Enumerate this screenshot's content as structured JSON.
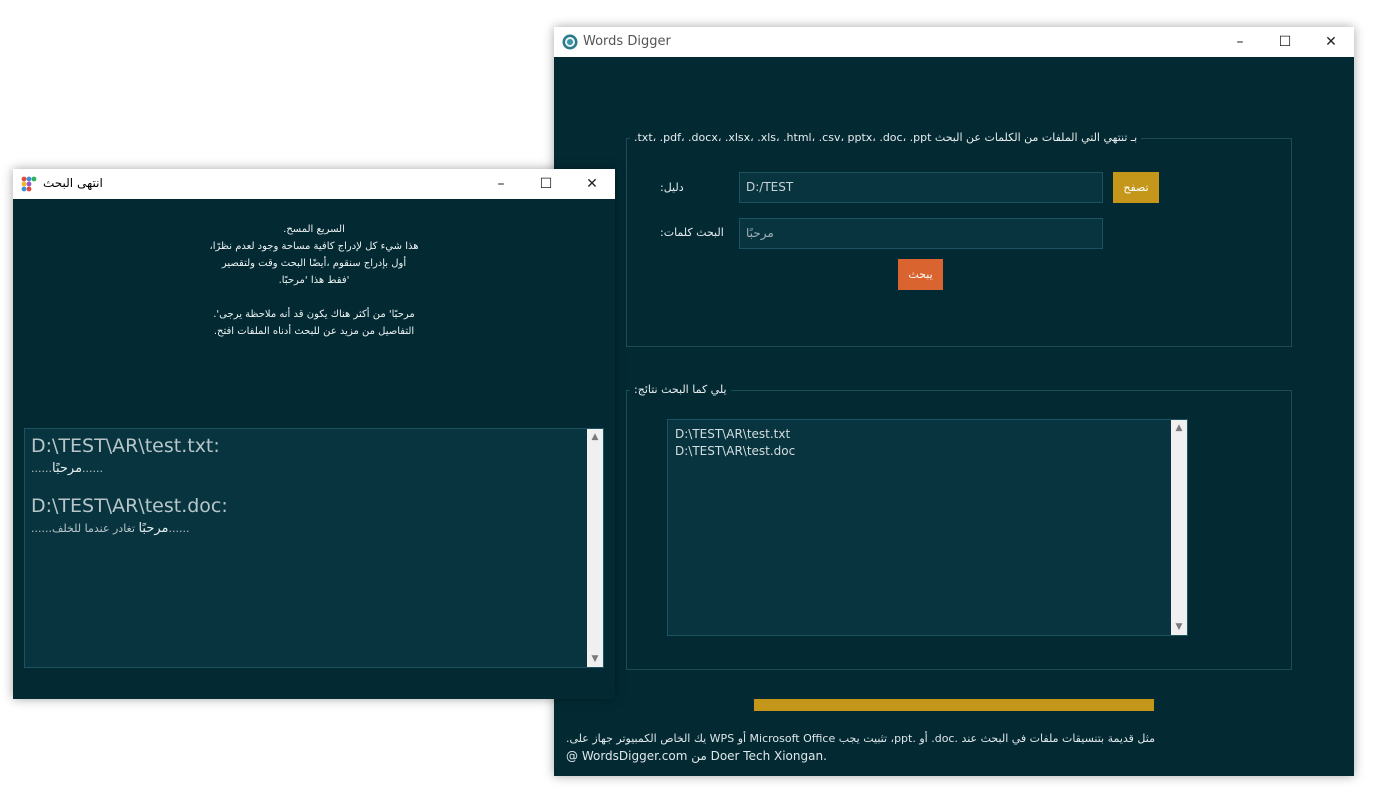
{
  "main_window": {
    "title": "Words Digger",
    "file_types_label": ".txt، .pdf، .docx، .xlsx، .xls، .html، .csv، pptx، .doc، .ppt بـ تنتهي التي الملفات من الكلمات عن البحث",
    "dir_label": ":دليل",
    "dir_value": "D:/TEST",
    "browse_label": "تصفح",
    "keywords_label": ":البحث كلمات",
    "keywords_value": "مرحبًا",
    "search_label": "يبحث",
    "results_label": ":يلي كما البحث نتائج",
    "results": [
      "D:\\TEST\\AR\\test.txt",
      "D:\\TEST\\AR\\test.doc"
    ],
    "progress": 1.0,
    "footer_line1": ".يك الخاص الكمبيوتر جهاز على WPS أو Microsoft Office تثبيت يجب ،ppt. أو .doc. مثل قديمة بتنسيقات ملفات في البحث عند",
    "footer_line2": "@ WordsDigger.com من Doer Tech Xiongan."
  },
  "done_window": {
    "title": "انتهى البحث",
    "message_lines": [
      ".السريع المسح",
      "،هذا شيء كل لإدراج كافية مساحة وجود لعدم نظرًا",
      "أول بإدراج سنقوم ،أيضًا البحث وقت ولتقصير",
      ".فقط هذا 'مرحبًا'",
      "",
      ".'مرحبًا' من أكثر هناك يكون قد أنه ملاحظة يرجى",
      ".التفاصيل من مزيد عن للبحث أدناه الملفات افتح"
    ],
    "results": [
      {
        "path": "D:\\TEST\\AR\\test.txt:",
        "prefix": "......",
        "match": "مرحبًا",
        "suffix": "......"
      },
      {
        "path": "D:\\TEST\\AR\\test.doc:",
        "prefix": "......",
        "match": "مرحبًا",
        "suffix": " تغادر عندما للخلف......"
      }
    ]
  },
  "icons": {
    "minimize": "minimize-icon",
    "maximize": "maximize-icon",
    "close": "close-icon",
    "app": "words-digger-app-icon"
  },
  "colors": {
    "background": "#032a33",
    "browse_button": "#c4961a",
    "search_button": "#d9642f",
    "progress_bar": "#c4961a"
  }
}
